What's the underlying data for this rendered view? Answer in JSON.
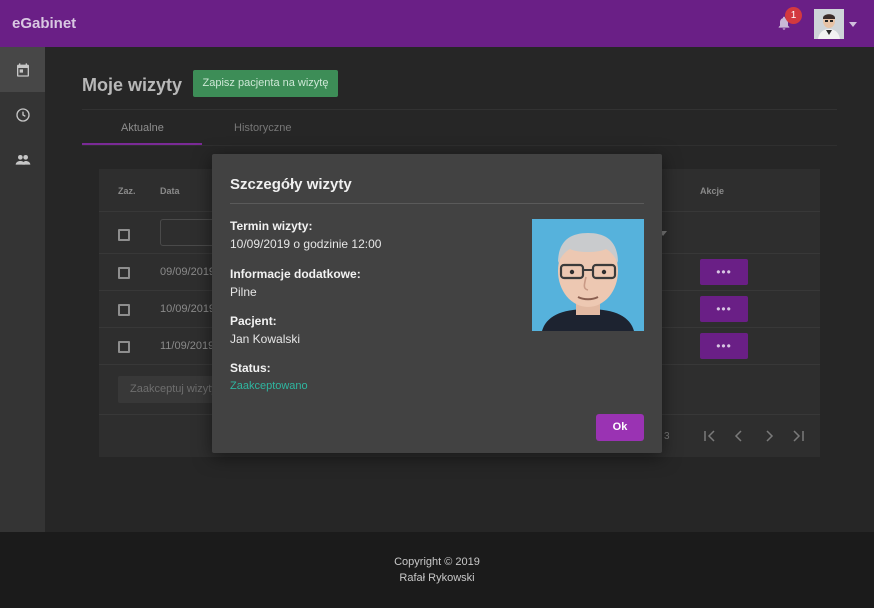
{
  "app": {
    "title": "eGabinet"
  },
  "header": {
    "notification_count": "1"
  },
  "page": {
    "title": "Moje wizyty",
    "add_button": "Zapisz pacjenta na wizytę",
    "tabs": [
      {
        "label": "Aktualne",
        "active": true
      },
      {
        "label": "Historyczne",
        "active": false
      }
    ]
  },
  "table": {
    "headers": {
      "select": "Zaz.",
      "date": "Data",
      "actions": "Akcje"
    },
    "rows": [
      {
        "date": "09/09/2019",
        "action": "•••"
      },
      {
        "date": "10/09/2019",
        "action": "•••"
      },
      {
        "date": "11/09/2019",
        "action": "•••"
      }
    ],
    "accept_button": "Zaakceptuj wizyty",
    "pagination": {
      "page_fragment": "3"
    }
  },
  "modal": {
    "title": "Szczegóły wizyty",
    "fields": {
      "term_label": "Termin wizyty:",
      "term_value": "10/09/2019 o godzinie 12:00",
      "info_label": "Informacje dodatkowe:",
      "info_value": "Pilne",
      "patient_label": "Pacjent:",
      "patient_value": "Jan Kowalski",
      "status_label": "Status:",
      "status_value": "Zaakceptowano"
    },
    "ok_button": "Ok"
  },
  "footer": {
    "line1": "Copyright © 2019",
    "line2": "Rafał Rykowski"
  },
  "colors": {
    "topbar": "#6a1f86",
    "primary_button": "#9a33b3",
    "success_button": "#3d8d57",
    "status_text": "#2fb6a0",
    "badge": "#d3393f"
  },
  "icons": {
    "sidebar": [
      "calendar-icon",
      "clock-icon",
      "people-icon"
    ],
    "header": [
      "bell-icon",
      "user-avatar",
      "chevron-down-icon"
    ],
    "pagination": [
      "first-page-icon",
      "previous-page-icon",
      "next-page-icon",
      "last-page-icon"
    ]
  }
}
